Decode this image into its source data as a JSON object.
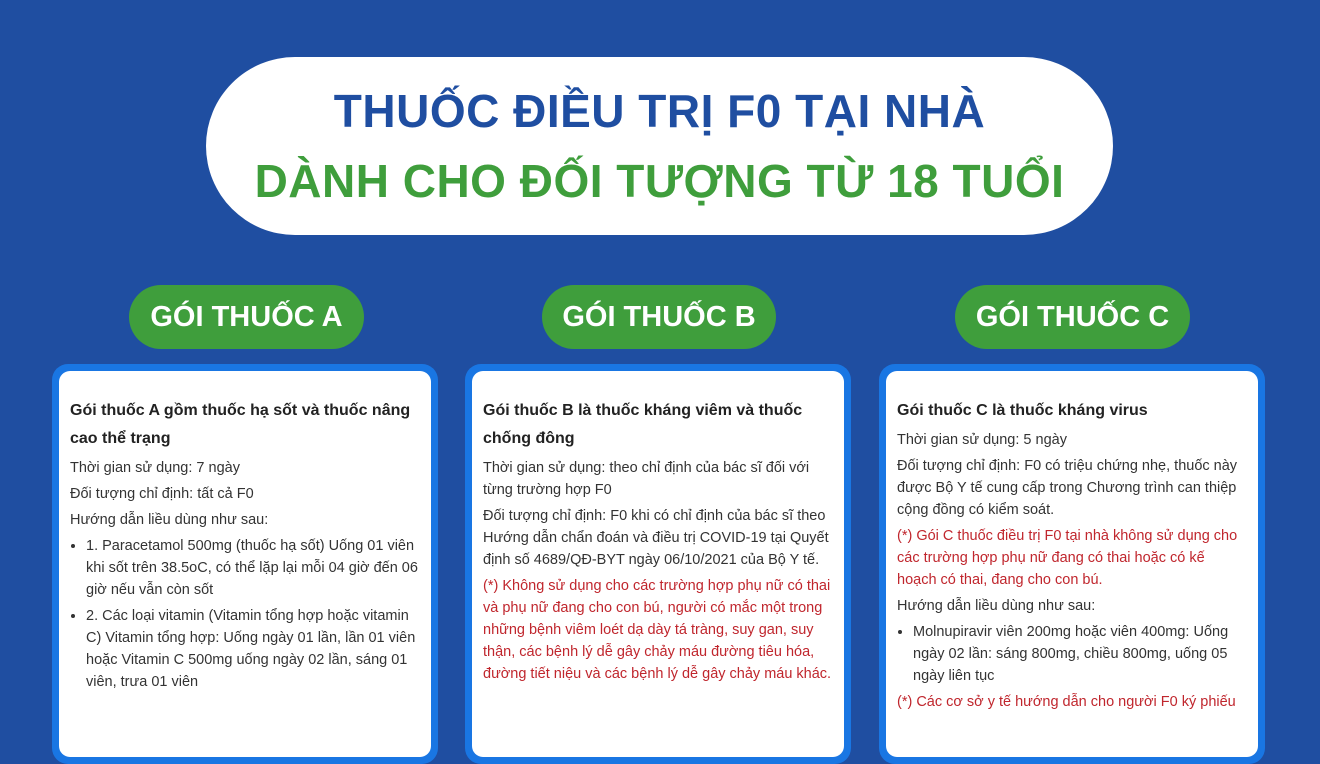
{
  "title": {
    "line1": "THUỐC ĐIỀU TRỊ F0 TẠI NHÀ",
    "line2": "DÀNH CHO ĐỐI TƯỢNG TỪ 18 TUỔI"
  },
  "packages": [
    {
      "label": "GÓI THUỐC A",
      "heading": "Gói thuốc A gồm thuốc hạ sốt và thuốc nâng cao thể trạng",
      "time": "Thời gian sử dụng: 7 ngày",
      "target": "Đối tượng chỉ định: tất cả F0",
      "guide": "Hướng dẫn liều dùng như sau:",
      "items": [
        "1. Paracetamol 500mg (thuốc hạ sốt) Uống 01 viên khi sốt trên 38.5oC, có thể lặp lại mỗi 04 giờ đến 06 giờ nếu vẫn còn sốt",
        "2. Các loại vitamin (Vitamin tổng hợp hoặc vitamin C) Vitamin tổng hợp: Uống ngày 01 lần, lần 01 viên hoặc Vitamin C 500mg uống ngày 02 lần, sáng 01 viên, trưa 01 viên"
      ]
    },
    {
      "label": "GÓI THUỐC B",
      "heading": "Gói thuốc B là thuốc kháng viêm và thuốc chống đông",
      "time": "Thời gian sử dụng: theo chỉ định của bác sĩ đối với từng trường hợp F0",
      "target": "Đối tượng chỉ định: F0 khi có chỉ định của bác sĩ theo Hướng dẫn chẩn đoán và điều trị COVID-19 tại Quyết định số 4689/QĐ-BYT ngày 06/10/2021 của Bộ Y tế.",
      "warning": "(*) Không sử dụng cho các trường hợp phụ nữ có thai và phụ nữ đang cho con bú, người có mắc một trong những bệnh viêm loét dạ dày tá tràng, suy gan, suy thận, các bệnh lý dễ gây chảy máu đường tiêu hóa, đường tiết niệu và các bệnh lý dễ gây chảy máu khác."
    },
    {
      "label": "GÓI THUỐC C",
      "heading": "Gói thuốc C là thuốc kháng virus",
      "time": "Thời gian sử dụng: 5 ngày",
      "target": "Đối tượng chỉ định: F0 có triệu chứng nhẹ, thuốc này được Bộ Y tế cung cấp trong Chương trình can thiệp cộng đồng có kiểm soát.",
      "warning": "(*) Gói C thuốc điều trị F0 tại nhà không sử dụng cho các trường hợp phụ nữ đang có thai hoặc có kế hoạch có thai, đang cho con bú.",
      "guide": "Hướng dẫn liều dùng như sau:",
      "items": [
        "Molnupiravir viên 200mg hoặc viên 400mg: Uống ngày 02 lần: sáng 800mg, chiều 800mg, uống 05 ngày liên tục"
      ],
      "warning2": "(*) Các cơ sở y tế hướng dẫn cho người F0 ký phiếu"
    }
  ]
}
